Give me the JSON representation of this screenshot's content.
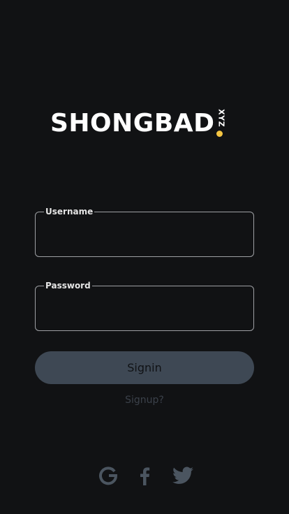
{
  "brand": {
    "name": "SHONGBAD",
    "tld": "XYZ",
    "dot_color": "#f5c542"
  },
  "login_form": {
    "username_label": "Username",
    "username_value": "",
    "password_label": "Password",
    "password_value": "",
    "signin_label": "Signin",
    "signup_link": "Signup?"
  },
  "social_login": {
    "providers": [
      "google-icon",
      "facebook-icon",
      "twitter-icon"
    ],
    "icon_color": "#4b5560"
  },
  "colors": {
    "background": "#111214",
    "field_border": "#9ea0a4",
    "button_bg": "#3e4854",
    "link": "#3b414a"
  }
}
